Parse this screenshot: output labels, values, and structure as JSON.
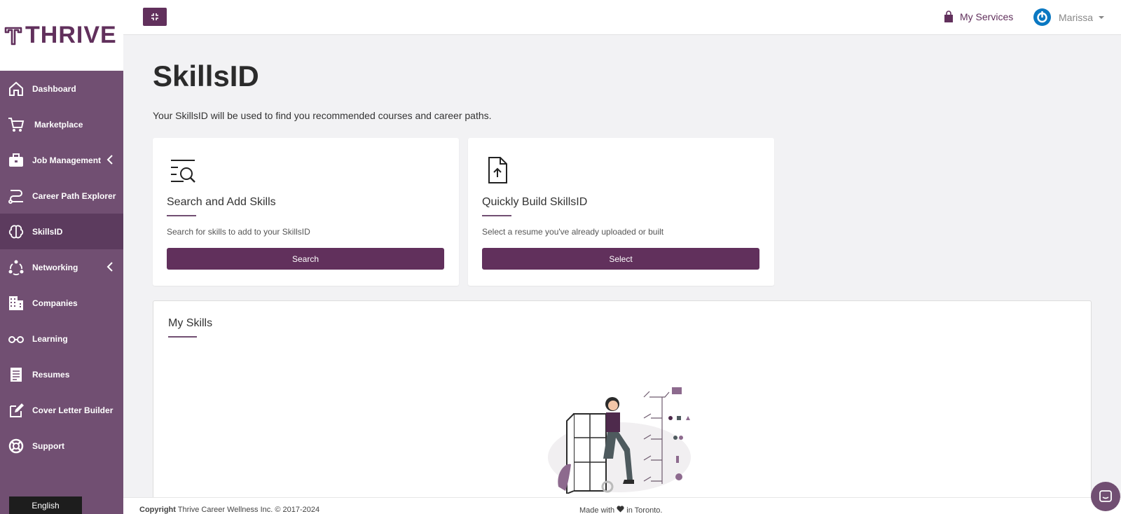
{
  "brand": {
    "logo_text": "THRIVE",
    "color": "#61305c",
    "sidebar_bg": "#714f72"
  },
  "sidebar": {
    "items": [
      {
        "label": "Dashboard",
        "icon": "home-icon"
      },
      {
        "label": "Marketplace",
        "icon": "cart-icon"
      },
      {
        "label": "Job Management",
        "icon": "briefcase-icon",
        "expandable": true
      },
      {
        "label": "Career Path Explorer",
        "icon": "path-icon"
      },
      {
        "label": "SkillsID",
        "icon": "brain-icon",
        "active": true
      },
      {
        "label": "Networking",
        "icon": "network-icon",
        "expandable": true
      },
      {
        "label": "Companies",
        "icon": "building-icon"
      },
      {
        "label": "Learning",
        "icon": "glasses-icon"
      },
      {
        "label": "Resumes",
        "icon": "document-icon"
      },
      {
        "label": "Cover Letter Builder",
        "icon": "edit-icon"
      },
      {
        "label": "Support",
        "icon": "lifebuoy-icon"
      }
    ],
    "language": "English"
  },
  "topbar": {
    "my_services": "My Services",
    "user_name": "Marissa"
  },
  "page": {
    "title": "SkillsID",
    "subtitle": "Your SkillsID will be used to find you recommended courses and career paths."
  },
  "cards": {
    "search": {
      "title": "Search and Add Skills",
      "description": "Search for skills to add to your SkillsID",
      "button": "Search"
    },
    "build": {
      "title": "Quickly Build SkillsID",
      "description": "Select a resume you've already uploaded or built",
      "button": "Select"
    }
  },
  "my_skills": {
    "title": "My Skills"
  },
  "footer": {
    "copyright_label": "Copyright",
    "copyright_text": " Thrive Career Wellness Inc. © 2017-2024",
    "made_prefix": "Made with ",
    "made_suffix": " in Toronto."
  }
}
